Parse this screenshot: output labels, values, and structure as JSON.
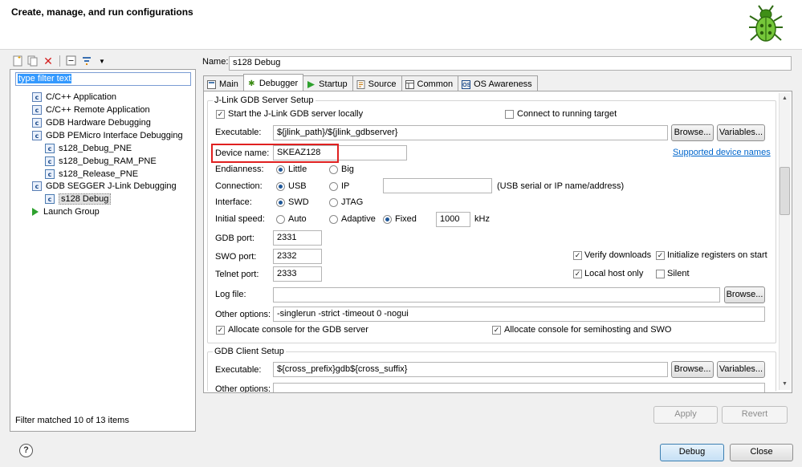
{
  "header": {
    "title": "Create, manage, and run configurations",
    "logo_icon": "bug-icon"
  },
  "left": {
    "toolbar": [
      "new-config-icon",
      "duplicate-icon",
      "delete-icon",
      "collapse-all-icon",
      "filter-icon",
      "dropdown-icon"
    ],
    "filter_value": "type filter text",
    "tree": [
      {
        "label": "C/C++ Application",
        "level": 0,
        "icon": "c-config-icon"
      },
      {
        "label": "C/C++ Remote Application",
        "level": 0,
        "icon": "c-config-icon"
      },
      {
        "label": "GDB Hardware Debugging",
        "level": 0,
        "icon": "c-config-icon"
      },
      {
        "label": "GDB PEMicro Interface Debugging",
        "level": 0,
        "icon": "c-config-icon"
      },
      {
        "label": "s128_Debug_PNE",
        "level": 1,
        "icon": "c-config-icon"
      },
      {
        "label": "s128_Debug_RAM_PNE",
        "level": 1,
        "icon": "c-config-icon"
      },
      {
        "label": "s128_Release_PNE",
        "level": 1,
        "icon": "c-config-icon"
      },
      {
        "label": "GDB SEGGER J-Link Debugging",
        "level": 0,
        "icon": "c-config-icon"
      },
      {
        "label": "s128 Debug",
        "level": 1,
        "icon": "c-config-icon",
        "selected": true
      },
      {
        "label": "Launch Group",
        "level": 0,
        "icon": "launch-icon"
      }
    ],
    "status": "Filter matched 10 of 13 items"
  },
  "config": {
    "name_label": "Name:",
    "name_value": "s128 Debug",
    "tabs": [
      {
        "label": "Main",
        "icon": "main-tab-icon"
      },
      {
        "label": "Debugger",
        "icon": "debugger-tab-icon",
        "active": true
      },
      {
        "label": "Startup",
        "icon": "startup-tab-icon"
      },
      {
        "label": "Source",
        "icon": "source-tab-icon"
      },
      {
        "label": "Common",
        "icon": "common-tab-icon"
      },
      {
        "label": "OS Awareness",
        "icon": "os-tab-icon"
      }
    ],
    "server": {
      "group_label": "J-Link GDB Server Setup",
      "start_locally_label": "Start the J-Link GDB server locally",
      "start_locally_checked": true,
      "connect_running_label": "Connect to running target",
      "connect_running_checked": false,
      "executable_label": "Executable:",
      "executable_value": "${jlink_path}/${jlink_gdbserver}",
      "browse_label": "Browse...",
      "variables_label": "Variables...",
      "device_label": "Device name:",
      "device_value": "SKEAZ128",
      "supported_devices_link": "Supported device names",
      "endianness_label": "Endianness:",
      "endianness_options": [
        "Little",
        "Big"
      ],
      "endianness_selected": "Little",
      "connection_label": "Connection:",
      "connection_options": [
        "USB",
        "IP"
      ],
      "connection_selected": "USB",
      "connection_hint": "(USB serial or IP name/address)",
      "interface_label": "Interface:",
      "interface_options": [
        "SWD",
        "JTAG"
      ],
      "interface_selected": "SWD",
      "speed_label": "Initial speed:",
      "speed_options": [
        "Auto",
        "Adaptive",
        "Fixed"
      ],
      "speed_selected": "Fixed",
      "speed_value": "1000",
      "speed_unit": "kHz",
      "gdb_port_label": "GDB port:",
      "gdb_port_value": "2331",
      "swo_port_label": "SWO port:",
      "swo_port_value": "2332",
      "telnet_port_label": "Telnet port:",
      "telnet_port_value": "2333",
      "verify_downloads_label": "Verify downloads",
      "verify_downloads_checked": true,
      "init_registers_label": "Initialize registers on start",
      "init_registers_checked": true,
      "local_host_only_label": "Local host only",
      "local_host_only_checked": true,
      "silent_label": "Silent",
      "silent_checked": false,
      "log_file_label": "Log file:",
      "log_file_value": "",
      "log_browse_label": "Browse...",
      "other_options_label": "Other options:",
      "other_options_value": "-singlerun -strict -timeout 0 -nogui",
      "alloc_console_gdb_label": "Allocate console for the GDB server",
      "alloc_console_gdb_checked": true,
      "alloc_console_semi_label": "Allocate console for semihosting and SWO",
      "alloc_console_semi_checked": true
    },
    "client": {
      "group_label": "GDB Client Setup",
      "executable_label": "Executable:",
      "executable_value": "${cross_prefix}gdb${cross_suffix}",
      "browse_label": "Browse...",
      "variables_label": "Variables...",
      "other_options_label": "Other options:"
    },
    "apply_label": "Apply",
    "revert_label": "Revert"
  },
  "footer": {
    "help_icon": "help-icon",
    "debug_label": "Debug",
    "close_label": "Close"
  }
}
